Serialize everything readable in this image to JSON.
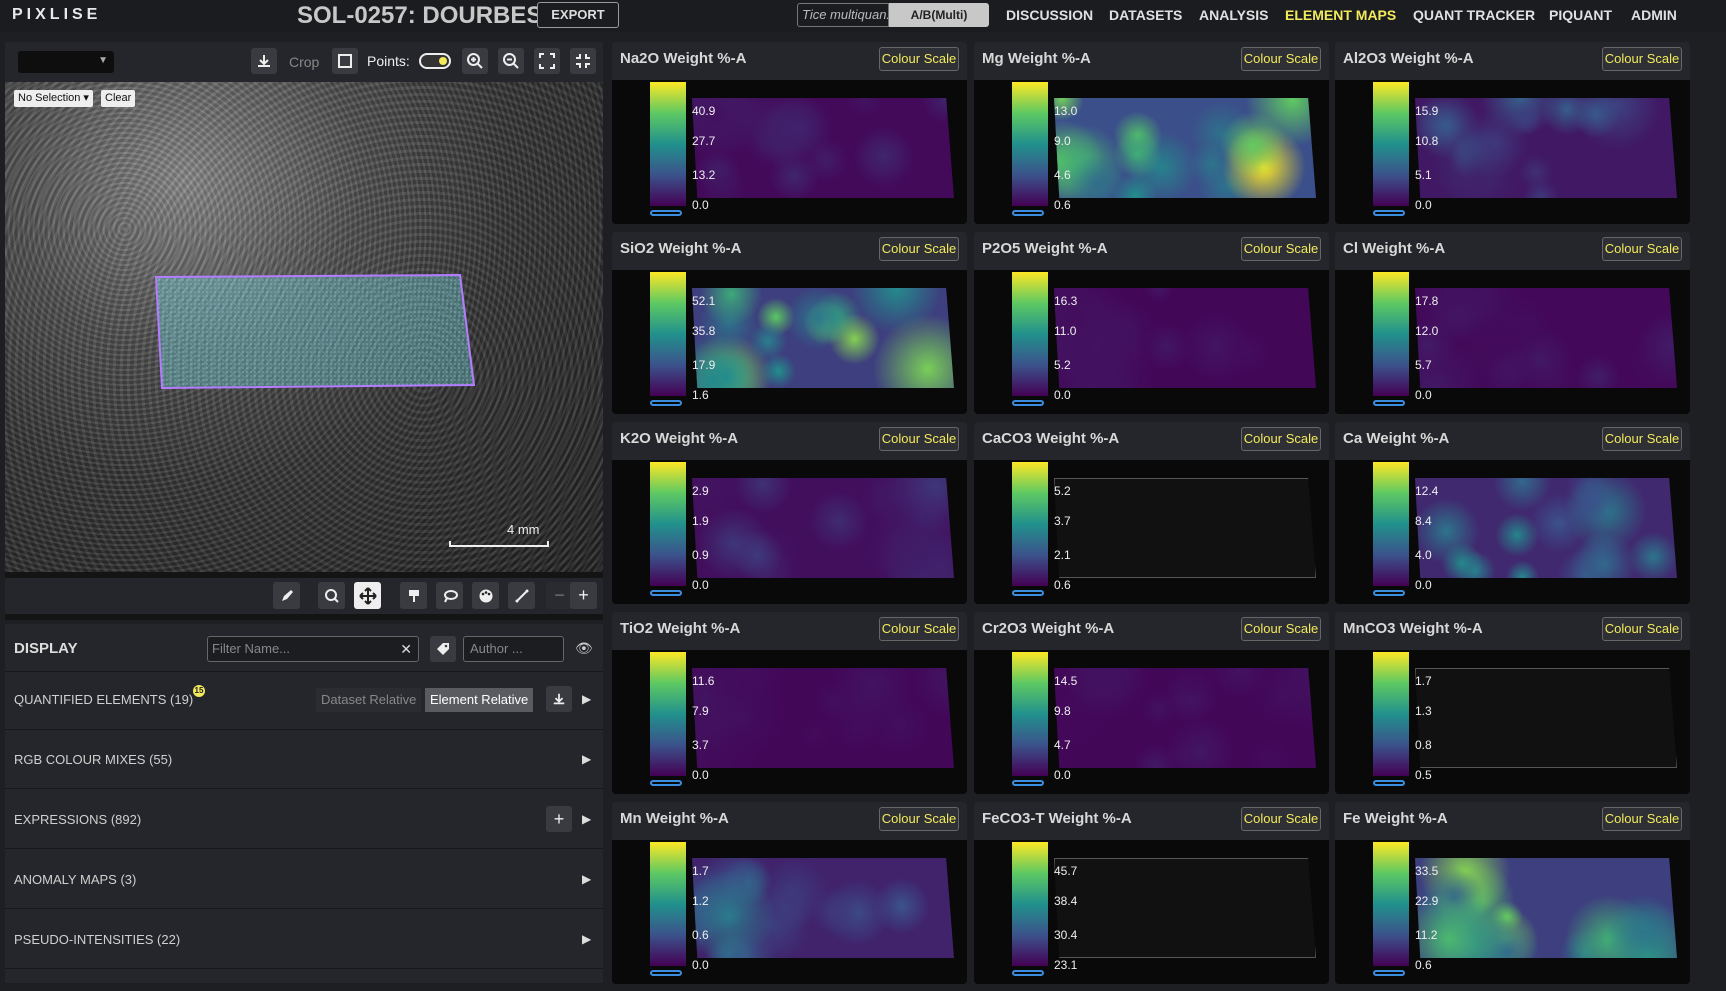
{
  "app": {
    "logo": "PIXLISE",
    "dataset_title": "SOL-0257: DOURBES",
    "export_label": "EXPORT",
    "quant_select": "Tice multiquan...",
    "ab_label": "A/B(Multi)"
  },
  "nav": [
    "DISCUSSION",
    "DATASETS",
    "ANALYSIS",
    "ELEMENT MAPS",
    "QUANT TRACKER",
    "PIQUANT",
    "ADMIN"
  ],
  "nav_active": "ELEMENT MAPS",
  "context_toolbar": {
    "crop_label": "Crop",
    "points_label": "Points:",
    "points_on": true
  },
  "context_image": {
    "selection_label": "No Selection ▾",
    "clear_label": "Clear",
    "scale_label": "4 mm"
  },
  "display": {
    "title": "DISPLAY",
    "filter_placeholder": "Filter Name...",
    "author_label": "Author ...",
    "rows": [
      {
        "label": "QUANTIFIED ELEMENTS",
        "count": "(19)",
        "badge": "15"
      },
      {
        "label": "RGB COLOUR MIXES",
        "count": "(55)"
      },
      {
        "label": "EXPRESSIONS",
        "count": "(892)"
      },
      {
        "label": "ANOMALY MAPS",
        "count": "(3)"
      },
      {
        "label": "PSEUDO-INTENSITIES",
        "count": "(22)"
      }
    ],
    "seg_dataset": "Dataset Relative",
    "seg_element": "Element Relative"
  },
  "colour_scale_label": "Colour Scale",
  "maps": [
    {
      "title": "Na2O Weight %-A",
      "ticks": [
        "40.9",
        "27.7",
        "13.2",
        "0.0"
      ],
      "fill": 0.08
    },
    {
      "title": "Mg Weight %-A",
      "ticks": [
        "13.0",
        "9.0",
        "4.6",
        "0.6"
      ],
      "fill": 0.7
    },
    {
      "title": "Al2O3 Weight %-A",
      "ticks": [
        "15.9",
        "10.8",
        "5.1",
        "0.0"
      ],
      "fill": 0.2
    },
    {
      "title": "SiO2 Weight %-A",
      "ticks": [
        "52.1",
        "35.8",
        "17.9",
        "1.6"
      ],
      "fill": 0.55
    },
    {
      "title": "P2O5 Weight %-A",
      "ticks": [
        "16.3",
        "11.0",
        "5.2",
        "0.0"
      ],
      "fill": 0.05
    },
    {
      "title": "Cl Weight %-A",
      "ticks": [
        "17.8",
        "12.0",
        "5.7",
        "0.0"
      ],
      "fill": 0.06
    },
    {
      "title": "K2O Weight %-A",
      "ticks": [
        "2.9",
        "1.9",
        "0.9",
        "0.0"
      ],
      "fill": 0.12
    },
    {
      "title": "CaCO3 Weight %-A",
      "ticks": [
        "5.2",
        "3.7",
        "2.1",
        "0.6"
      ],
      "fill": 0.0
    },
    {
      "title": "Ca Weight %-A",
      "ticks": [
        "12.4",
        "8.4",
        "4.0",
        "0.0"
      ],
      "fill": 0.35
    },
    {
      "title": "TiO2 Weight %-A",
      "ticks": [
        "11.6",
        "7.9",
        "3.7",
        "0.0"
      ],
      "fill": 0.05
    },
    {
      "title": "Cr2O3 Weight %-A",
      "ticks": [
        "14.5",
        "9.8",
        "4.7",
        "0.0"
      ],
      "fill": 0.05
    },
    {
      "title": "MnCO3 Weight %-A",
      "ticks": [
        "1.7",
        "1.3",
        "0.8",
        "0.5"
      ],
      "fill": 0.0
    },
    {
      "title": "Mn Weight %-A",
      "ticks": [
        "1.7",
        "1.2",
        "0.6",
        "0.0"
      ],
      "fill": 0.3
    },
    {
      "title": "FeCO3-T Weight %-A",
      "ticks": [
        "45.7",
        "38.4",
        "30.4",
        "23.1"
      ],
      "fill": 0.0
    },
    {
      "title": "Fe Weight %-A",
      "ticks": [
        "33.5",
        "22.9",
        "11.2",
        "0.6"
      ],
      "fill": 0.55
    }
  ],
  "colors": {
    "accent": "#f2ea5c",
    "viridis_low": "#440154",
    "viridis_high": "#fde725",
    "selection": "#b47cff"
  }
}
